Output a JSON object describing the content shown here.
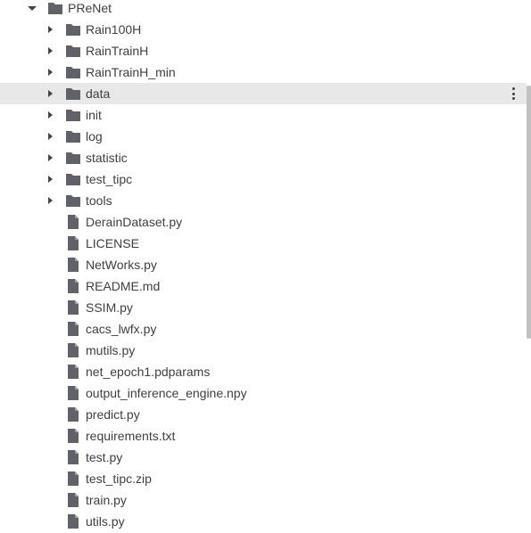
{
  "root": {
    "name": "PReNet",
    "expanded": true
  },
  "folders": [
    {
      "name": "Rain100H"
    },
    {
      "name": "RainTrainH"
    },
    {
      "name": "RainTrainH_min"
    },
    {
      "name": "data",
      "selected": true
    },
    {
      "name": "init"
    },
    {
      "name": "log"
    },
    {
      "name": "statistic"
    },
    {
      "name": "test_tipc"
    },
    {
      "name": "tools"
    }
  ],
  "files": [
    {
      "name": "DerainDataset.py"
    },
    {
      "name": "LICENSE"
    },
    {
      "name": "NetWorks.py"
    },
    {
      "name": "README.md"
    },
    {
      "name": "SSIM.py"
    },
    {
      "name": "cacs_lwfx.py"
    },
    {
      "name": "mutils.py"
    },
    {
      "name": "net_epoch1.pdparams"
    },
    {
      "name": "output_inference_engine.npy"
    },
    {
      "name": "predict.py"
    },
    {
      "name": "requirements.txt"
    },
    {
      "name": "test.py"
    },
    {
      "name": "test_tipc.zip"
    },
    {
      "name": "train.py"
    },
    {
      "name": "utils.py"
    }
  ],
  "icons": {
    "expanded": "caret-down-icon",
    "collapsed": "caret-right-icon",
    "folder": "folder-icon",
    "file": "file-icon",
    "more": "more-vert-icon"
  },
  "colors": {
    "selected_row": "#e8e8e8",
    "icon": "#5f6368",
    "text": "#3c4043"
  }
}
